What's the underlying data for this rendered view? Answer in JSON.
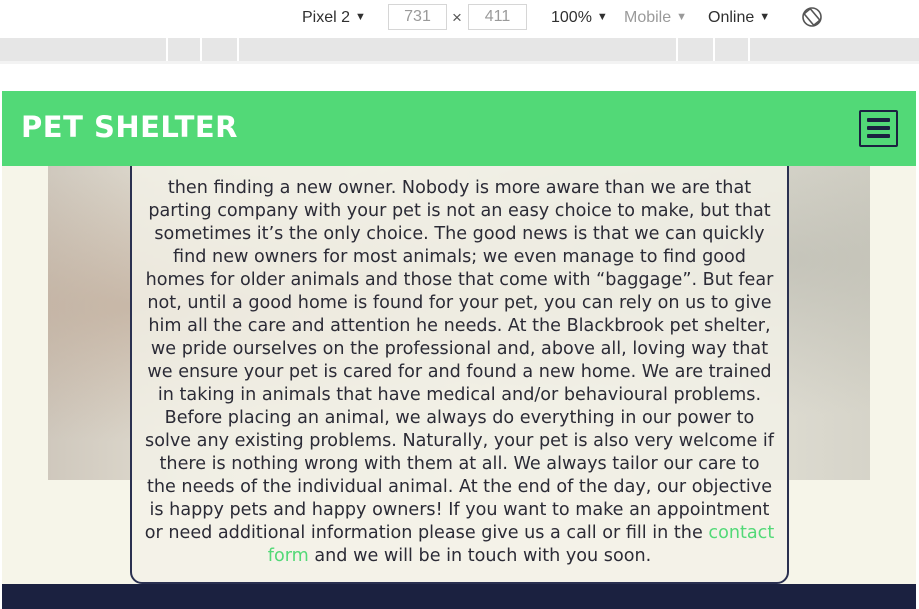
{
  "devtools": {
    "device": "Pixel 2",
    "width": "731",
    "times": "×",
    "height": "411",
    "zoom": "100%",
    "mode": "Mobile",
    "network": "Online",
    "rotate_icon": "rotate-icon"
  },
  "site": {
    "logo": "PET SHELTER",
    "menu_icon": "hamburger-menu-icon",
    "body_text_before_link": "then finding a new owner. Nobody is more aware than we are that parting company with your pet is not an easy choice to make, but that sometimes it’s the only choice. The good news is that we can quickly find new owners for most animals; we even manage to find good homes for older animals and those that come with “baggage”. But fear not, until a good home is found for your pet, you can rely on us to give him all the care and attention he needs. At the Blackbrook pet shelter, we pride ourselves on the professional and, above all, loving way that we ensure your pet is cared for and found a new home. We are trained in taking in animals that have medical and/or behavioural problems. Before placing an animal, we always do everything in our power to solve any existing problems. Naturally, your pet is also very welcome if there is nothing wrong with them at all. We always tailor our care to the needs of the individual animal. At the end of the day, our objective is happy pets and happy owners! If you want to make an appointment or need additional information please give us a call or fill in the",
    "link_text": "contact form",
    "body_text_after_link": "and we will be in touch with you soon."
  },
  "colors": {
    "header_green": "#52d977",
    "navy": "#1b2140",
    "page_bg": "#f6f5e9"
  }
}
